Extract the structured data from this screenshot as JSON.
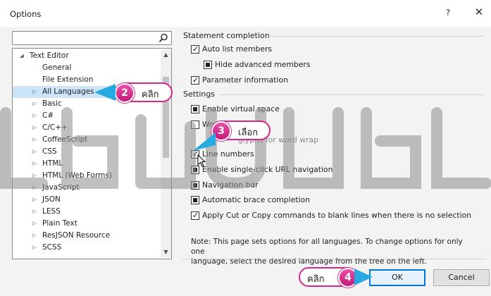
{
  "window": {
    "title": "Options",
    "help_label": "?",
    "close_label": "✕"
  },
  "search": {
    "value": "",
    "icon": "search-icon"
  },
  "tree": {
    "items": [
      {
        "label": "Text Editor",
        "expanded": true
      },
      {
        "label": "General"
      },
      {
        "label": "File Extension"
      },
      {
        "label": "All Languages",
        "selected": true
      },
      {
        "label": "Basic"
      },
      {
        "label": "C#"
      },
      {
        "label": "C/C++"
      },
      {
        "label": "CoffeeScript"
      },
      {
        "label": "CSS"
      },
      {
        "label": "HTML"
      },
      {
        "label": "HTML (Web Forms)"
      },
      {
        "label": "JavaScript"
      },
      {
        "label": "JSON"
      },
      {
        "label": "LESS"
      },
      {
        "label": "Plain Text"
      },
      {
        "label": "ResJSON Resource"
      },
      {
        "label": "SCSS"
      }
    ]
  },
  "statement_completion": {
    "title": "Statement completion",
    "auto_list_members": "Auto list members",
    "hide_advanced_members": "Hide advanced members",
    "parameter_information": "Parameter information"
  },
  "settings": {
    "title": "Settings",
    "enable_virtual_space": "Enable virtual space",
    "word_wrap": "Wo",
    "show_glyphs": "glyphs for word wrap",
    "line_numbers": "Line numbers",
    "single_click_url": "Enable single-click URL navigation",
    "navigation_bar": "Navigation bar",
    "automatic_brace": "Automatic brace completion",
    "apply_cut_copy": "Apply Cut or Copy commands to blank lines when there is no selection"
  },
  "note": {
    "line1": "Note: This page sets options for all languages. To change options for only one",
    "line2": "language, select the desired language from the tree on the left."
  },
  "buttons": {
    "ok": "OK",
    "cancel": "Cancel"
  },
  "callouts": [
    {
      "number": "2",
      "text": "คลิก"
    },
    {
      "number": "3",
      "text": "เลือก"
    },
    {
      "number": "4",
      "text": "คลิก"
    }
  ],
  "colors": {
    "accent": "#d6278a",
    "arrow": "#27a9e1",
    "selection": "#cce4f7",
    "ok_border": "#0078d7"
  }
}
